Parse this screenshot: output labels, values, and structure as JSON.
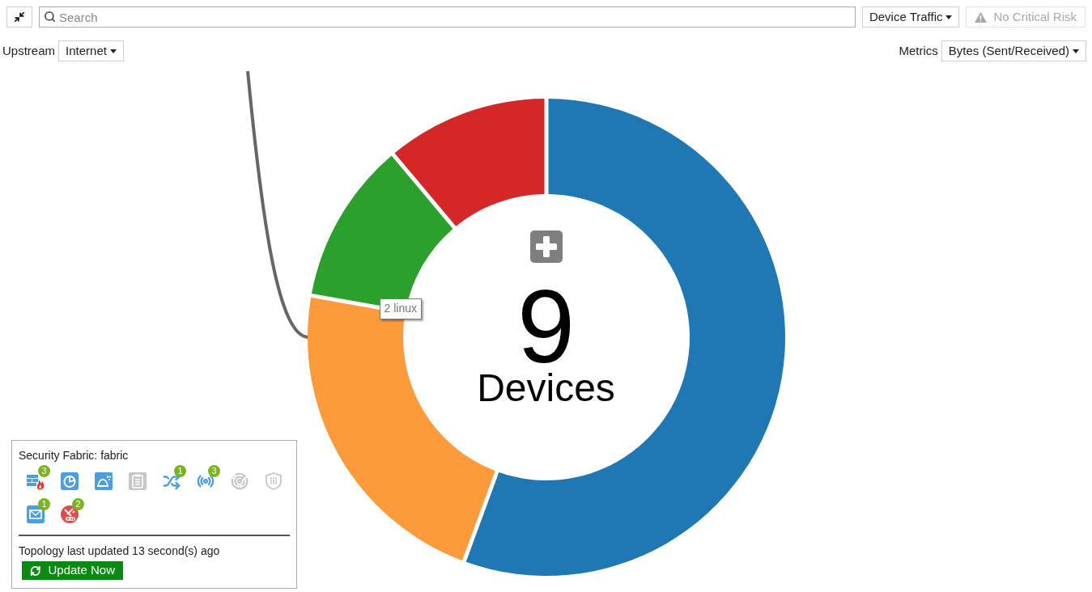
{
  "toolbar": {
    "search": {
      "placeholder": "Search"
    },
    "view_dropdown": {
      "label": "Device Traffic"
    },
    "risk_button": {
      "label": "No Critical Risk",
      "disabled": true
    }
  },
  "filters": {
    "upstream": {
      "label": "Upstream",
      "value": "Internet"
    },
    "metrics": {
      "label": "Metrics",
      "value": "Bytes (Sent/Received)"
    }
  },
  "chart": {
    "total": "9",
    "total_label": "Devices",
    "tooltip": "2 linux",
    "chart_data": {
      "type": "donut",
      "values": [
        55.6,
        22.2,
        11.1,
        11.1
      ],
      "colors": [
        "#1f78b4",
        "#fd9a3c",
        "#2ca02c",
        "#d62728"
      ]
    }
  },
  "fabric_panel": {
    "title": "Security Fabric: fabric",
    "devices": [
      {
        "disabled": false,
        "alert": false,
        "badge": "3"
      },
      {
        "disabled": false,
        "alert": false
      },
      {
        "disabled": false,
        "alert": false
      },
      {
        "disabled": true,
        "alert": false
      },
      {
        "disabled": false,
        "alert": false,
        "badge": "1"
      },
      {
        "disabled": false,
        "alert": false,
        "badge": "3"
      },
      {
        "disabled": true,
        "alert": false
      },
      {
        "disabled": true,
        "alert": false
      },
      {
        "disabled": false,
        "alert": false,
        "badge": "1"
      },
      {
        "disabled": false,
        "alert": true,
        "badge": "2"
      }
    ],
    "updated_text": "Topology last updated 13 second(s) ago",
    "update_button": "Update Now"
  }
}
